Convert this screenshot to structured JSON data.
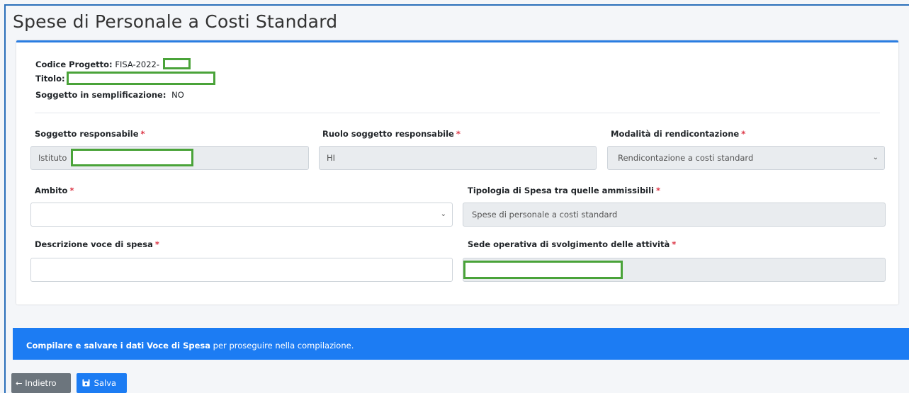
{
  "page": {
    "title": "Spese di Personale a Costi Standard"
  },
  "project": {
    "code_label": "Codice Progetto:",
    "code_value": "FISA-2022-",
    "title_label": "Titolo:",
    "simpl_label": "Soggetto in semplificazione:",
    "simpl_value": "NO"
  },
  "form": {
    "required_mark": "*",
    "soggetto": {
      "label": "Soggetto responsabile",
      "value": "Istituto"
    },
    "ruolo": {
      "label": "Ruolo soggetto responsabile",
      "value": "HI"
    },
    "modalita": {
      "label": "Modalità di rendicontazione",
      "value": "Rendicontazione a costi standard"
    },
    "ambito": {
      "label": "Ambito",
      "value": ""
    },
    "tipologia": {
      "label": "Tipologia di Spesa tra quelle ammissibili",
      "value": "Spese di personale a costi standard"
    },
    "descrizione": {
      "label": "Descrizione voce di spesa",
      "value": ""
    },
    "sede": {
      "label": "Sede operativa di svolgimento delle attività",
      "value": ""
    }
  },
  "banner": {
    "bold_text": "Compilare e salvare i dati Voce di Spesa",
    "rest_text": " per proseguire nella compilazione."
  },
  "buttons": {
    "back": "Indietro",
    "save": "Salva"
  },
  "icons": {
    "back": "arrow-left-icon",
    "save": "floppy-disk-icon",
    "select": "chevron-down-icon"
  },
  "colors": {
    "accent": "#1c7cf3",
    "redaction": "#4aa339",
    "required": "#dc3545"
  }
}
